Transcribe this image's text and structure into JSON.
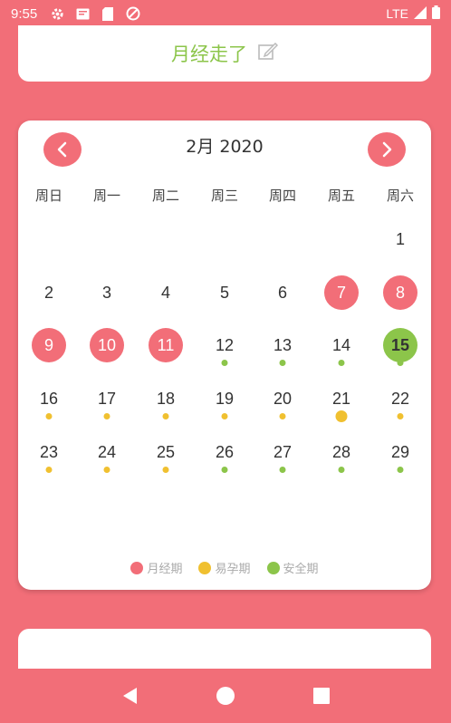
{
  "status_bar": {
    "time": "9:55",
    "network": "LTE",
    "icons": [
      "gear-icon",
      "message-icon",
      "sim-icon",
      "no-disturb-icon",
      "signal-icon",
      "battery-icon"
    ]
  },
  "top_card": {
    "message": "月经走了",
    "edit_icon": "edit-icon"
  },
  "calendar": {
    "title": "2月 2020",
    "prev_icon": "chevron-left-icon",
    "next_icon": "chevron-right-icon",
    "weekdays": [
      "周日",
      "周一",
      "周二",
      "周三",
      "周四",
      "周五",
      "周六"
    ],
    "days": [
      {
        "n": "1",
        "type": "normal",
        "dot": ""
      },
      {
        "n": "2",
        "type": "normal",
        "dot": ""
      },
      {
        "n": "3",
        "type": "normal",
        "dot": ""
      },
      {
        "n": "4",
        "type": "normal",
        "dot": ""
      },
      {
        "n": "5",
        "type": "normal",
        "dot": ""
      },
      {
        "n": "6",
        "type": "normal",
        "dot": ""
      },
      {
        "n": "7",
        "type": "period",
        "dot": ""
      },
      {
        "n": "8",
        "type": "period",
        "dot": ""
      },
      {
        "n": "9",
        "type": "period",
        "dot": ""
      },
      {
        "n": "10",
        "type": "period",
        "dot": ""
      },
      {
        "n": "11",
        "type": "period",
        "dot": ""
      },
      {
        "n": "12",
        "type": "normal",
        "dot": "safe"
      },
      {
        "n": "13",
        "type": "normal",
        "dot": "safe"
      },
      {
        "n": "14",
        "type": "normal",
        "dot": "safe"
      },
      {
        "n": "15",
        "type": "today",
        "dot": "safe"
      },
      {
        "n": "16",
        "type": "normal",
        "dot": "fertile"
      },
      {
        "n": "17",
        "type": "normal",
        "dot": "fertile"
      },
      {
        "n": "18",
        "type": "normal",
        "dot": "fertile"
      },
      {
        "n": "19",
        "type": "normal",
        "dot": "fertile"
      },
      {
        "n": "20",
        "type": "normal",
        "dot": "fertile"
      },
      {
        "n": "21",
        "type": "normal",
        "dot": "fertile-big"
      },
      {
        "n": "22",
        "type": "normal",
        "dot": "fertile"
      },
      {
        "n": "23",
        "type": "normal",
        "dot": "fertile"
      },
      {
        "n": "24",
        "type": "normal",
        "dot": "fertile"
      },
      {
        "n": "25",
        "type": "normal",
        "dot": "fertile"
      },
      {
        "n": "26",
        "type": "normal",
        "dot": "safe"
      },
      {
        "n": "27",
        "type": "normal",
        "dot": "safe"
      },
      {
        "n": "28",
        "type": "normal",
        "dot": "safe"
      },
      {
        "n": "29",
        "type": "normal",
        "dot": "safe"
      }
    ],
    "first_weekday_index": 6,
    "legend": [
      {
        "label": "月经期",
        "color": "#f26e78"
      },
      {
        "label": "易孕期",
        "color": "#f0c030"
      },
      {
        "label": "安全期",
        "color": "#8cc54a"
      }
    ]
  },
  "colors": {
    "accent": "#f26e78",
    "safe": "#8cc54a",
    "fertile": "#f0c030"
  },
  "nav_bar": {
    "icons": [
      "back-icon",
      "home-icon",
      "recents-icon"
    ]
  }
}
